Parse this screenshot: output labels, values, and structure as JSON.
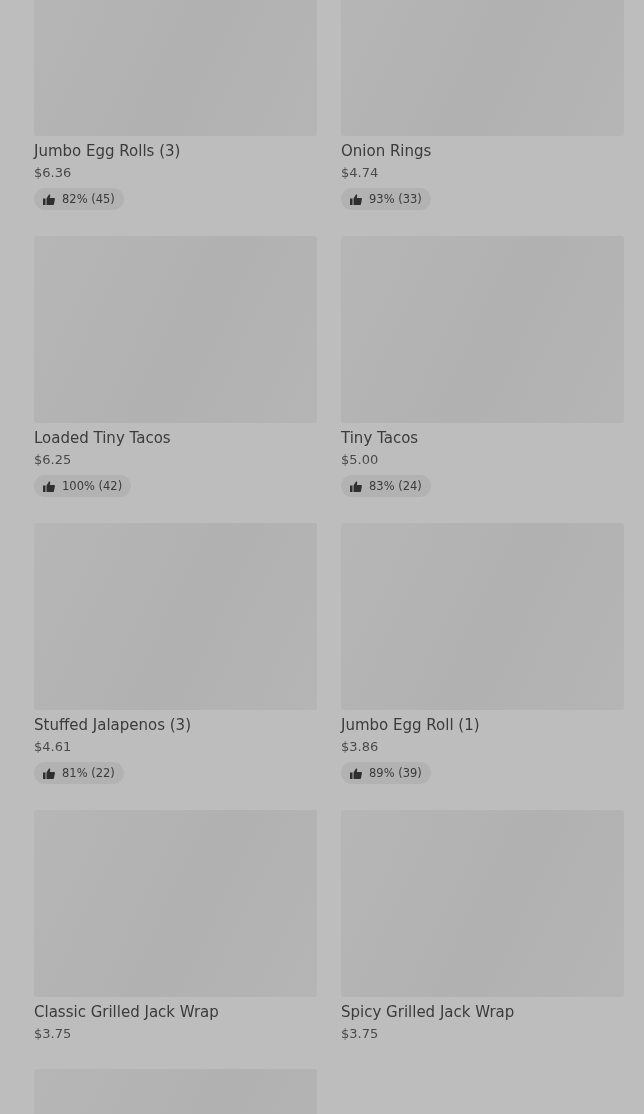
{
  "menu_items": [
    {
      "kind": "item",
      "name": "Jumbo Egg Rolls (3)",
      "price": "$6.36",
      "rating": "82% (45)"
    },
    {
      "kind": "item",
      "name": "Onion Rings",
      "price": "$4.74",
      "rating": "93% (33)"
    },
    {
      "kind": "item",
      "name": "Loaded Tiny Tacos",
      "price": "$6.25",
      "rating": "100% (42)"
    },
    {
      "kind": "item",
      "name": "Tiny Tacos",
      "price": "$5.00",
      "rating": "83% (24)"
    },
    {
      "kind": "item",
      "name": "Stuffed Jalapenos (3)",
      "price": "$4.61",
      "rating": "81% (22)"
    },
    {
      "kind": "item",
      "name": "Jumbo Egg Roll (1)",
      "price": "$3.86",
      "rating": "89% (39)"
    },
    {
      "kind": "item",
      "name": "Classic Grilled Jack Wrap",
      "price": "$3.75"
    },
    {
      "kind": "item",
      "name": "Spicy Grilled Jack Wrap",
      "price": "$3.75"
    },
    {
      "kind": "picture"
    }
  ]
}
